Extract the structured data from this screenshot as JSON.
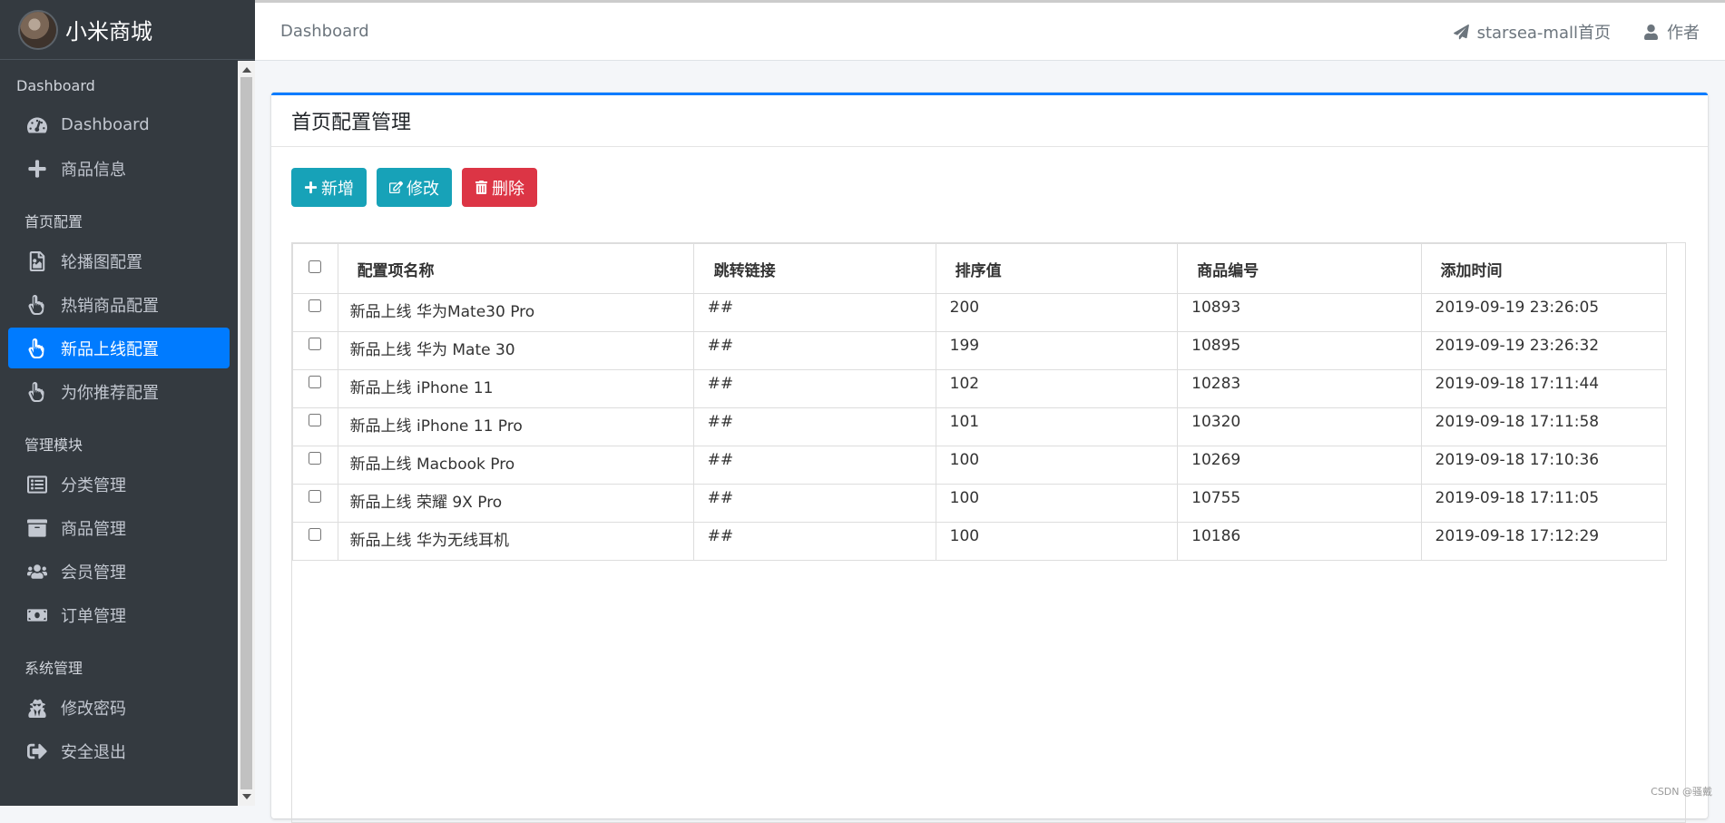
{
  "brand": {
    "name": "小米商城"
  },
  "sidebar": {
    "sections": [
      {
        "header": "Dashboard",
        "items": [
          {
            "label": "Dashboard",
            "icon": "dashboard-gauge-icon"
          },
          {
            "label": "商品信息",
            "icon": "plus-icon"
          }
        ]
      },
      {
        "header": "首页配置",
        "items": [
          {
            "label": "轮播图配置",
            "icon": "image-icon"
          },
          {
            "label": "热销商品配置",
            "icon": "hand-pointer-icon"
          },
          {
            "label": "新品上线配置",
            "icon": "hand-pointer-icon",
            "active": true
          },
          {
            "label": "为你推荐配置",
            "icon": "hand-pointer-icon"
          }
        ]
      },
      {
        "header": "管理模块",
        "items": [
          {
            "label": "分类管理",
            "icon": "list-alt-icon"
          },
          {
            "label": "商品管理",
            "icon": "archive-icon"
          },
          {
            "label": "会员管理",
            "icon": "users-icon"
          },
          {
            "label": "订单管理",
            "icon": "money-bill-icon"
          }
        ]
      },
      {
        "header": "系统管理",
        "items": [
          {
            "label": "修改密码",
            "icon": "user-secret-icon"
          },
          {
            "label": "安全退出",
            "icon": "sign-out-icon"
          }
        ]
      }
    ]
  },
  "navbar": {
    "breadcrumb": "Dashboard",
    "home_link": "starsea-mall首页",
    "author_link": "作者"
  },
  "card": {
    "title": "首页配置管理",
    "buttons": {
      "add": "新增",
      "edit": "修改",
      "delete": "删除"
    }
  },
  "table": {
    "columns": [
      "配置项名称",
      "跳转链接",
      "排序值",
      "商品编号",
      "添加时间"
    ],
    "rows": [
      [
        "新品上线 华为Mate30 Pro",
        "##",
        "200",
        "10893",
        "2019-09-19 23:26:05"
      ],
      [
        "新品上线 华为 Mate 30",
        "##",
        "199",
        "10895",
        "2019-09-19 23:26:32"
      ],
      [
        "新品上线 iPhone 11",
        "##",
        "102",
        "10283",
        "2019-09-18 17:11:44"
      ],
      [
        "新品上线 iPhone 11 Pro",
        "##",
        "101",
        "10320",
        "2019-09-18 17:11:58"
      ],
      [
        "新品上线 Macbook Pro",
        "##",
        "100",
        "10269",
        "2019-09-18 17:10:36"
      ],
      [
        "新品上线 荣耀 9X Pro",
        "##",
        "100",
        "10755",
        "2019-09-18 17:11:05"
      ],
      [
        "新品上线 华为无线耳机",
        "##",
        "100",
        "10186",
        "2019-09-18 17:12:29"
      ]
    ]
  },
  "watermark": "CSDN @骚戴",
  "colors": {
    "sidebar": "#343a40",
    "active": "#007bff",
    "info": "#17a2b8",
    "danger": "#dc3545"
  }
}
